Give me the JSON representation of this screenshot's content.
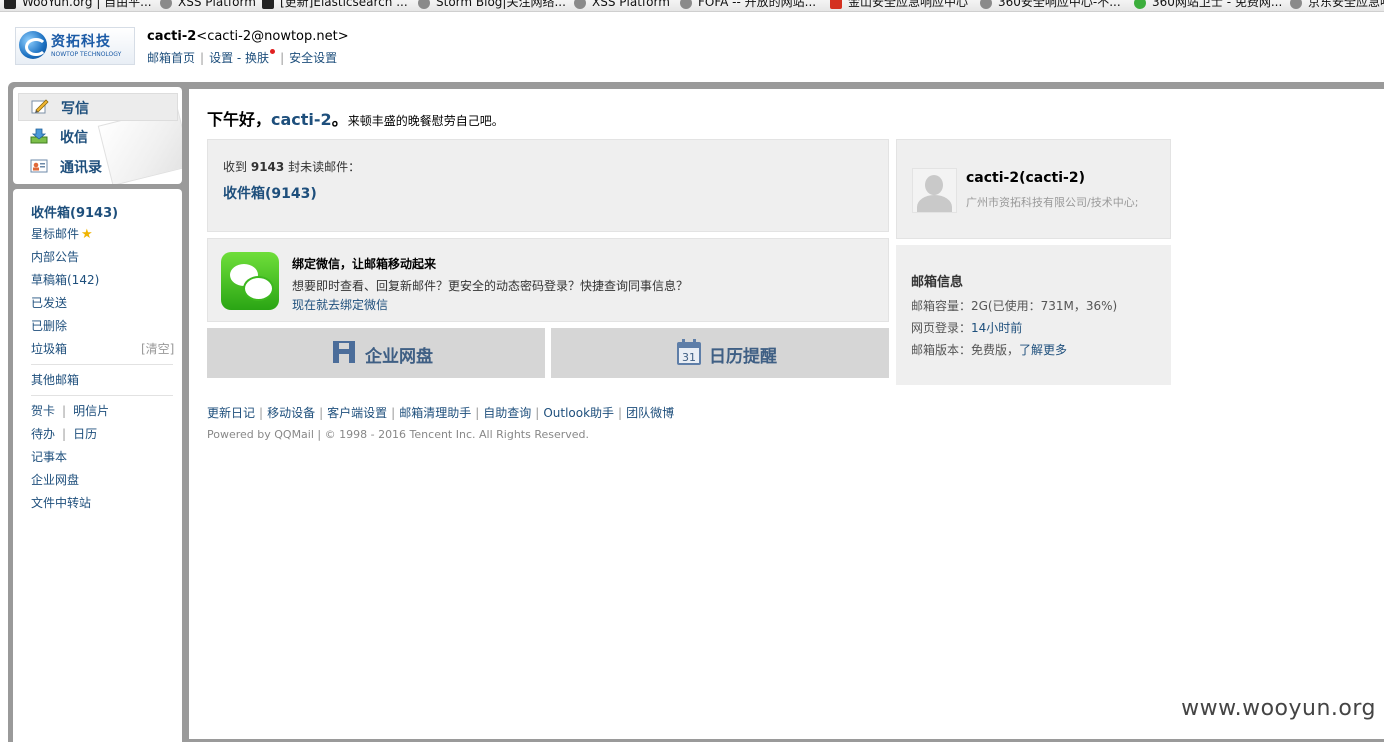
{
  "bookmarks": [
    {
      "label": "WooYun.org | 自由平...",
      "icon": "wooyun-icon"
    },
    {
      "label": "XSS Platform",
      "icon": "globe-icon"
    },
    {
      "label": "[更新]Elasticsearch ...",
      "icon": "film-icon"
    },
    {
      "label": "Storm Blog|关注网络...",
      "icon": "globe-icon"
    },
    {
      "label": "XSS Platform",
      "icon": "globe-icon"
    },
    {
      "label": "FOFA -- 开放的网站...",
      "icon": "globe-icon"
    },
    {
      "label": "金山安全应急响应中心",
      "icon": "kingsoft-icon"
    },
    {
      "label": "360安全响应中心-不...",
      "icon": "globe-icon"
    },
    {
      "label": "360网站卫士 - 免费网...",
      "icon": "360-shield-icon"
    },
    {
      "label": "京东安全应急响",
      "icon": "globe-icon"
    }
  ],
  "header": {
    "logo_cn": "资拓科技",
    "logo_en": "NOWTOP TECHNOLOGY",
    "account_name": "cacti-2",
    "account_email": "<cacti-2@nowtop.net>",
    "links": [
      "邮箱首页",
      "设置",
      "换肤",
      "安全设置"
    ]
  },
  "quick_actions": {
    "write": "写信",
    "inbox": "收信",
    "contacts": "通讯录"
  },
  "nav": {
    "inbox": "收件箱(9143)",
    "starred": "星标邮件",
    "internal": "内部公告",
    "drafts": "草稿箱(142)",
    "sent": "已发送",
    "deleted": "已删除",
    "spam": "垃圾箱",
    "spam_clear": "[清空]",
    "other": "其他邮箱",
    "card": "贺卡",
    "postcard": "明信片",
    "todo": "待办",
    "calendar": "日历",
    "notes": "记事本",
    "disk": "企业网盘",
    "transfer": "文件中转站"
  },
  "greeting": {
    "hello": "下午好，",
    "name": "cacti-2",
    "punct": "。",
    "tip": "来顿丰盛的晚餐慰劳自己吧。"
  },
  "unread": {
    "prefix": "收到",
    "count": "9143",
    "suffix": "封未读邮件：",
    "inbox_link": "收件箱(9143)"
  },
  "wechat": {
    "title": "绑定微信，让邮箱移动起来",
    "desc": "想要即时查看、回复新邮件？更安全的动态密码登录？快捷查询同事信息？",
    "link": "现在就去绑定微信"
  },
  "buttons": {
    "disk": "企业网盘",
    "calendar": "日历提醒",
    "calendar_day": "31"
  },
  "profile": {
    "name": "cacti-2(cacti-2)",
    "org": "广州市资拓科技有限公司/技术中心;"
  },
  "mailbox_info": {
    "title": "邮箱信息",
    "capacity": "邮箱容量：2G(已使用：731M，36%)",
    "last_login_label": "网页登录：",
    "last_login": "14小时前",
    "version_label": "邮箱版本：免费版，",
    "version_link": "了解更多"
  },
  "footer": {
    "links": [
      "更新日记",
      "移动设备",
      "客户端设置",
      "邮箱清理助手",
      "自助查询",
      "Outlook助手",
      "团队微博"
    ],
    "copyright": "Powered by QQMail  | © 1998 - 2016 Tencent Inc. All Rights Reserved."
  },
  "watermark": "www.wooyun.org"
}
